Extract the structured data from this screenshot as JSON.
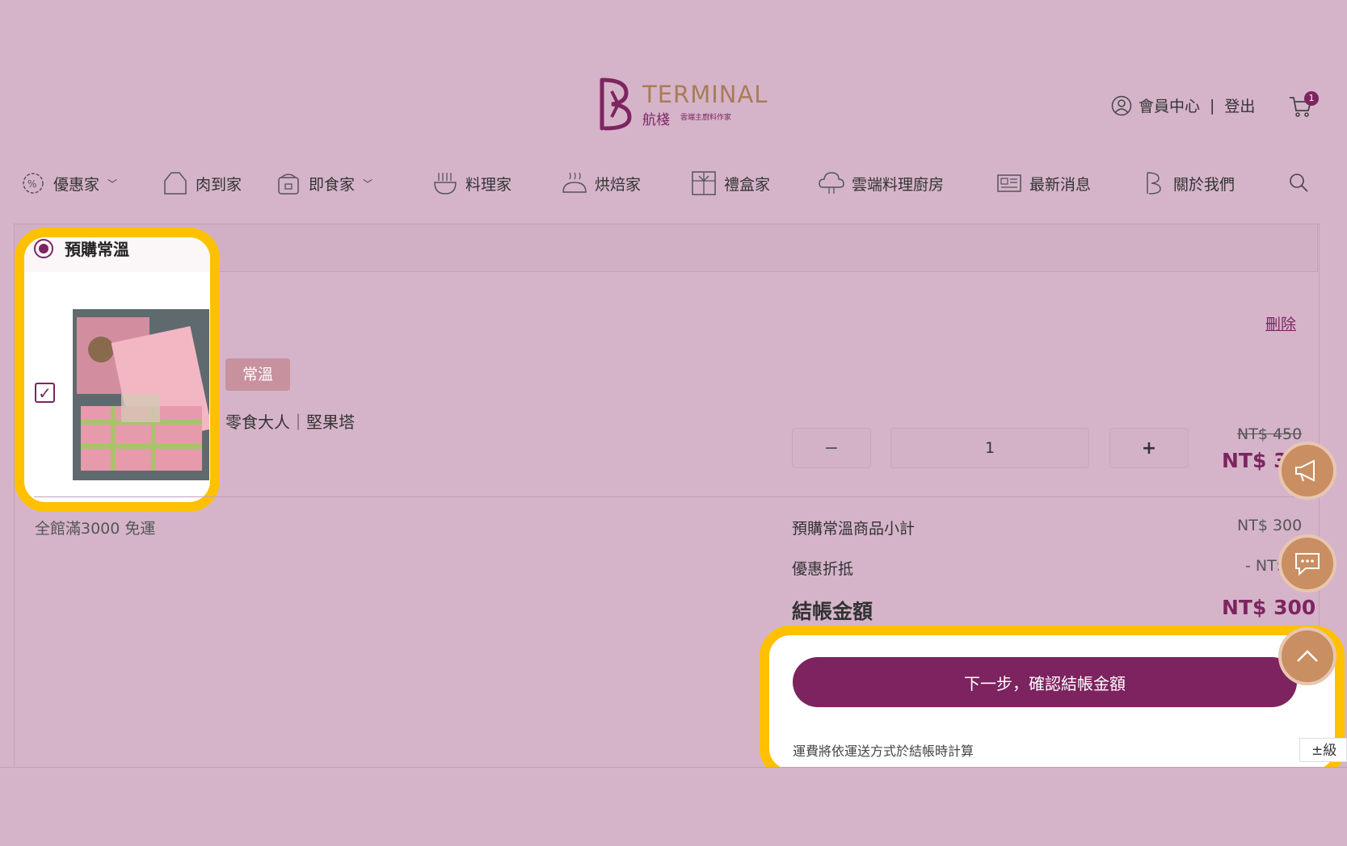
{
  "header": {
    "logo_text": "TERMINAL",
    "logo_cn": "航棧",
    "logo_sub": "雲端主廚料作家",
    "member_label": "會員中心",
    "separator": "|",
    "logout_label": "登出",
    "cart_count": "1"
  },
  "nav": {
    "items": [
      {
        "label": "優惠家",
        "icon": "discount-gear-icon",
        "has_caret": true
      },
      {
        "label": "肉到家",
        "icon": "meat-icon",
        "has_caret": false
      },
      {
        "label": "即食家",
        "icon": "rice-cooker-icon",
        "has_caret": true
      },
      {
        "label": "料理家",
        "icon": "noodle-bowl-icon",
        "has_caret": false
      },
      {
        "label": "烘焙家",
        "icon": "bakery-icon",
        "has_caret": false
      },
      {
        "label": "禮盒家",
        "icon": "gift-box-icon",
        "has_caret": false
      },
      {
        "label": "雲端料理廚房",
        "icon": "cloud-kitchen-icon",
        "has_caret": false
      },
      {
        "label": "最新消息",
        "icon": "news-icon",
        "has_caret": false
      },
      {
        "label": "關於我們",
        "icon": "brand-b-icon",
        "has_caret": false
      }
    ]
  },
  "cart": {
    "group_label": "預購常溫",
    "delete_label": "刪除",
    "item": {
      "tag": "常溫",
      "name": "零食大人｜堅果塔",
      "quantity": "1",
      "qty_minus": "−",
      "qty_plus": "+",
      "price_original": "NT$ 450",
      "price_sale": "NT$ 30"
    },
    "free_shipping_note": "全館滿3000 免運",
    "subtotal_label": "預購常溫商品小計",
    "subtotal_value": "NT$ 300",
    "discount_label": "優惠折抵",
    "discount_value": "- NT$",
    "total_label": "結帳金額",
    "total_value": "NT$ 300",
    "next_button": "下一步，確認結帳金額",
    "shipping_note": "運費將依運送方式於結帳時計算"
  },
  "recaptcha_label": "±級"
}
